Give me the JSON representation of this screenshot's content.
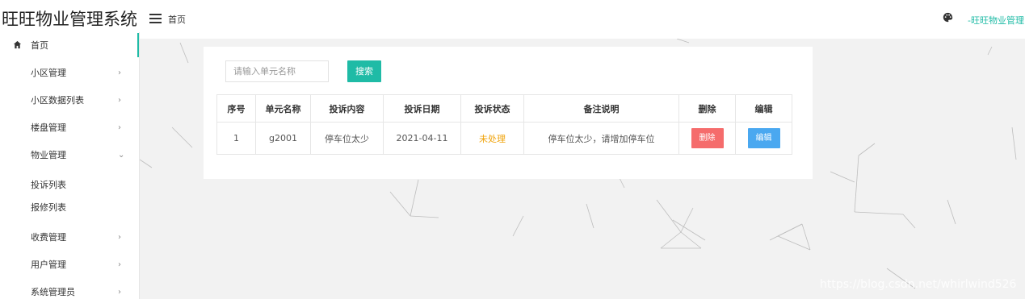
{
  "app": {
    "title": "旺旺物业管理系统"
  },
  "header": {
    "breadcrumb": "首页",
    "user": "-旺旺物业管理"
  },
  "sidebar": {
    "items": [
      {
        "label": "首页",
        "arrow": "",
        "active": true
      },
      {
        "label": "小区管理",
        "arrow": "›"
      },
      {
        "label": "小区数据列表",
        "arrow": "›"
      },
      {
        "label": "楼盘管理",
        "arrow": "›"
      },
      {
        "label": "物业管理",
        "arrow": "⌄"
      },
      {
        "label": "投诉列表",
        "arrow": ""
      },
      {
        "label": "报修列表",
        "arrow": ""
      },
      {
        "label": "收费管理",
        "arrow": "›"
      },
      {
        "label": "用户管理",
        "arrow": "›"
      },
      {
        "label": "系统管理员",
        "arrow": "›"
      }
    ]
  },
  "search": {
    "placeholder": "请输入单元名称",
    "button": "搜索"
  },
  "table": {
    "headers": [
      "序号",
      "单元名称",
      "投诉内容",
      "投诉日期",
      "投诉状态",
      "备注说明",
      "删除",
      "编辑"
    ],
    "rows": [
      {
        "index": "1",
        "unit": "g2001",
        "content": "停车位太少",
        "date": "2021-04-11",
        "status": "未处理",
        "remark": "停车位太少，请增加停车位",
        "delete": "删除",
        "edit": "编辑"
      }
    ]
  },
  "colors": {
    "accent": "#1fbba6",
    "danger": "#f56c6c",
    "primary": "#4aa8f0",
    "warning": "#f0a30a"
  },
  "watermark": "https://blog.csdn.net/whirlwind526"
}
